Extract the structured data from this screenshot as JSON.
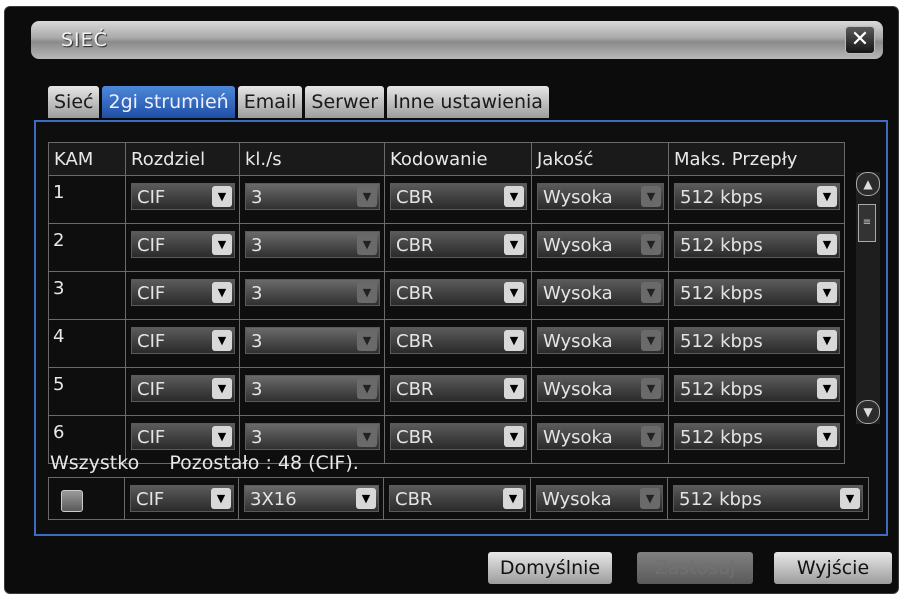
{
  "window": {
    "title": "SIEĆ",
    "close_icon": "close-icon"
  },
  "tabs": [
    "Sieć",
    "2gi strumień",
    "Email",
    "Serwer",
    "Inne ustawienia"
  ],
  "active_tab": 1,
  "table": {
    "headers": [
      "KAM",
      "Rozdziel",
      "kl./s",
      "Kodowanie",
      "Jakość",
      "Maks. Przepły"
    ],
    "rows": [
      {
        "cam": "1",
        "res": "CIF",
        "fps": "3",
        "enc": "CBR",
        "qual": "Wysoka",
        "bit": "512 kbps"
      },
      {
        "cam": "2",
        "res": "CIF",
        "fps": "3",
        "enc": "CBR",
        "qual": "Wysoka",
        "bit": "512 kbps"
      },
      {
        "cam": "3",
        "res": "CIF",
        "fps": "3",
        "enc": "CBR",
        "qual": "Wysoka",
        "bit": "512 kbps"
      },
      {
        "cam": "4",
        "res": "CIF",
        "fps": "3",
        "enc": "CBR",
        "qual": "Wysoka",
        "bit": "512 kbps"
      },
      {
        "cam": "5",
        "res": "CIF",
        "fps": "3",
        "enc": "CBR",
        "qual": "Wysoka",
        "bit": "512 kbps"
      },
      {
        "cam": "6",
        "res": "CIF",
        "fps": "3",
        "enc": "CBR",
        "qual": "Wysoka",
        "bit": "512 kbps"
      }
    ]
  },
  "all": {
    "label": "Wszystko",
    "remaining": "Pozostało : 48 (CIF).",
    "res": "CIF",
    "fps": "3X16",
    "enc": "CBR",
    "qual": "Wysoka",
    "bit": "512 kbps"
  },
  "buttons": {
    "default": "Domyślnie",
    "apply": "Zastosuj",
    "exit": "Wyjście"
  }
}
